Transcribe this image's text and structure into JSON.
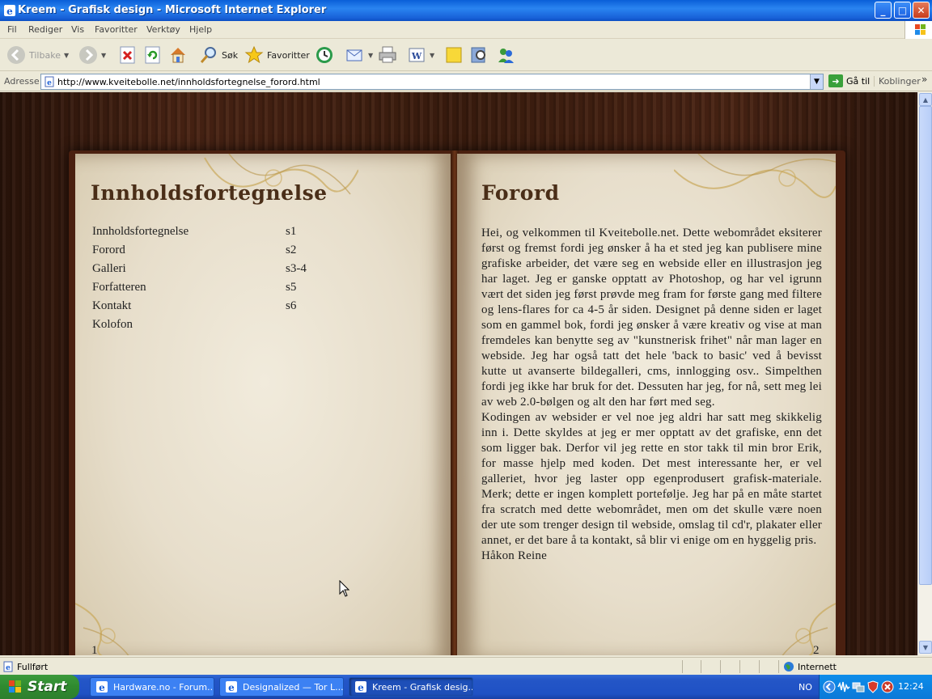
{
  "window": {
    "title": "Kreem - Grafisk design - Microsoft Internet Explorer",
    "min_label": "_",
    "max_label": "□",
    "close_label": "✕"
  },
  "menu": [
    "Fil",
    "Rediger",
    "Vis",
    "Favoritter",
    "Verktøy",
    "Hjelp"
  ],
  "toolbar": {
    "back_label": "Tilbake",
    "search_label": "Søk",
    "favorites_label": "Favoritter"
  },
  "address": {
    "label": "Adresse",
    "url": "http://www.kveitebolle.net/innholdsfortegnelse_forord.html",
    "go_label": "Gå til",
    "links_label": "Koblinger"
  },
  "book": {
    "left": {
      "heading": "Innholdsfortegnelse",
      "toc": [
        {
          "title": "Innholdsfortegnelse",
          "page": "s1"
        },
        {
          "title": "Forord",
          "page": "s2"
        },
        {
          "title": "Galleri",
          "page": "s3-4"
        },
        {
          "title": "Forfatteren",
          "page": "s5"
        },
        {
          "title": "Kontakt",
          "page": "s6"
        },
        {
          "title": "Kolofon",
          "page": ""
        }
      ],
      "page_number": "1"
    },
    "right": {
      "heading": "Forord",
      "paragraph1": "Hei, og velkommen til Kveitebolle.net. Dette webområdet eksiterer først og fremst fordi jeg ønsker å ha et sted jeg kan publisere mine grafiske arbeider, det være seg en webside eller en illustrasjon jeg har laget. Jeg er ganske opptatt av Photoshop, og har vel igrunn vært det siden jeg først prøvde meg fram for første gang med filtere og lens-flares for ca 4-5 år siden. Designet på denne siden er laget som en gammel bok, fordi jeg ønsker å være kreativ og vise at man fremdeles kan benytte seg av \"kunstnerisk frihet\" når man lager en webside. Jeg har også tatt det hele 'back to basic' ved å bevisst kutte ut avanserte bildegalleri, cms, innlogging osv.. Simpelthen fordi jeg ikke har bruk for det. Dessuten har jeg, for nå, sett meg lei av web 2.0-bølgen og alt den har ført med seg.",
      "paragraph2": "Kodingen av websider er vel noe jeg aldri har satt meg skikkelig inn i. Dette skyldes at jeg er mer opptatt av det grafiske, enn det som ligger bak. Derfor vil jeg rette en stor takk til min bror Erik, for masse hjelp med koden. Det mest interessante her, er vel galleriet, hvor jeg laster opp egenprodusert grafisk-materiale. Merk; dette er ingen komplett portefølje. Jeg har på en måte startet fra scratch med dette webområdet, men om det skulle være noen der ute som trenger design til webside, omslag til cd'r, plakater eller annet, er det bare å ta kontakt, så blir vi enige om en hyggelig pris.",
      "signature": "Håkon Reine",
      "page_number": "2"
    }
  },
  "status": {
    "text": "Fullført",
    "zone": "Internett"
  },
  "taskbar": {
    "start_label": "Start",
    "tasks": [
      "Hardware.no - Forum...",
      "Designalized — Tor L...",
      "Kreem - Grafisk desig..."
    ],
    "language": "NO",
    "clock": "12:24"
  }
}
